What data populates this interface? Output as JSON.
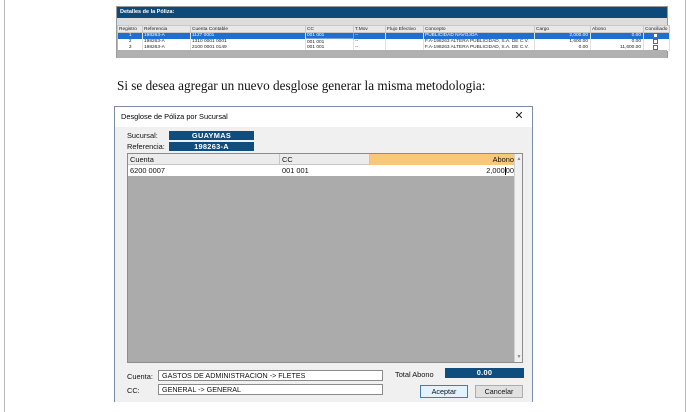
{
  "detalle": {
    "title": "Detalles de la Póliza:",
    "columns": [
      "Registro",
      "Referencia",
      "Cuenta Contable",
      "CC",
      "T.Mov",
      "Flujo Efectivo",
      "Concepto",
      "Cargo",
      "Abono",
      "Conciliado"
    ],
    "rows": [
      {
        "registro": "1",
        "referencia": "198263-A",
        "cuenta": "1127 0001",
        "cc": "001 001",
        "tmov": "--",
        "flujo": "",
        "concepto": "PUBLICIDAD NAVOJOA",
        "cargo": "2,000.00",
        "abono": "0.00",
        "selected": true
      },
      {
        "registro": "2",
        "referencia": "198263-A",
        "cuenta": "1310 0001 0001",
        "cc": "001 001",
        "tmov": "--",
        "flujo": "",
        "concepto": "F.A-198263 ALTERA PUBLICIDAD, S.A. DE C.V.",
        "cargo": "1,600.00",
        "abono": "0.00",
        "selected": false
      },
      {
        "registro": "3",
        "referencia": "198263-A",
        "cuenta": "2100 0001 0149",
        "cc": "001 001",
        "tmov": "--",
        "flujo": "",
        "concepto": "F.A-198263 ALTERA PUBLICIDAD, S.A. DE C.V.",
        "cargo": "0.00",
        "abono": "11,600.00",
        "selected": false
      }
    ]
  },
  "paragraph": "Si se desea agregar un nuevo desglose generar la misma metodologia:",
  "dialog": {
    "title": "Desglose de Póliza por Sucursal",
    "sucursal_label": "Sucursal:",
    "sucursal_value": "GUAYMAS",
    "referencia_label": "Referencia:",
    "referencia_value": "198263-A",
    "grid": {
      "headers": {
        "cuenta": "Cuenta",
        "cc": "CC",
        "abono": "Abono"
      },
      "rows": [
        {
          "cuenta": "6200 0007",
          "cc": "001 001",
          "abono_a": "2,000",
          "abono_b": "00"
        }
      ]
    },
    "cuenta_label": "Cuenta:",
    "cuenta_value": "GASTOS DE ADMINISTRACION -> FLETES",
    "cc_label": "CC:",
    "cc_value": "GENERAL -> GENERAL",
    "total_label": "Total Abono",
    "total_value": "0.00",
    "accept_label": "Aceptar",
    "cancel_label": "Cancelar",
    "close_glyph": "✕"
  },
  "colors": {
    "header_blue": "#0f4d7e",
    "selected_row": "#1e6fd0",
    "abono_header": "#f7c77a"
  }
}
